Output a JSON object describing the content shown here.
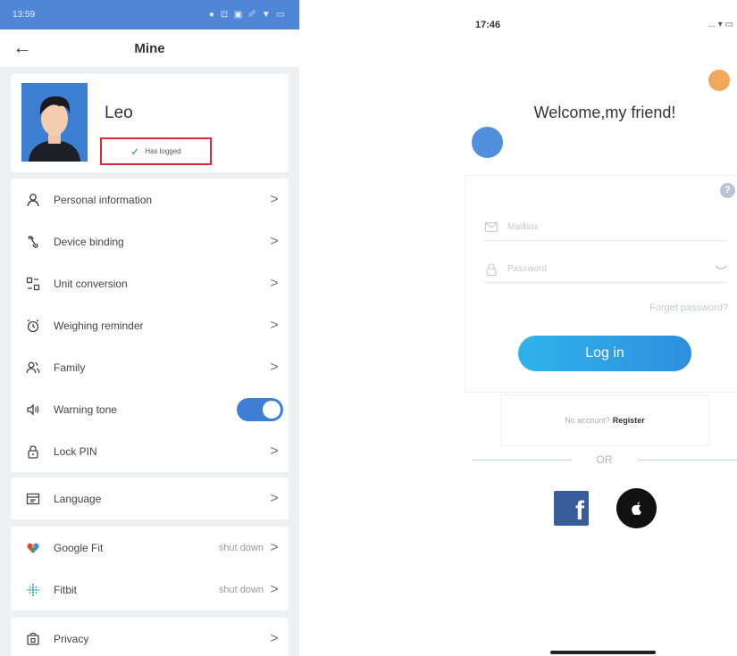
{
  "left": {
    "status": {
      "time": "13:59",
      "icons": "● ⊡ ▣ ␥ ▼ ▭"
    },
    "header": {
      "title": "Mine",
      "back": "←"
    },
    "profile": {
      "name": "Leo",
      "status": "Has logged",
      "check": "✓"
    },
    "menu_main": [
      {
        "icon": "person-icon",
        "label": "Personal information",
        "chev": ">"
      },
      {
        "icon": "link-icon",
        "label": "Device binding",
        "chev": ">"
      },
      {
        "icon": "unit-conversion-icon",
        "label": "Unit conversion",
        "chev": ">"
      },
      {
        "icon": "alarm-clock-icon",
        "label": "Weighing reminder",
        "chev": ">"
      },
      {
        "icon": "family-icon",
        "label": "Family",
        "chev": ">"
      },
      {
        "icon": "speaker-icon",
        "label": "Warning tone",
        "toggle": true
      },
      {
        "icon": "lock-icon",
        "label": "Lock PIN",
        "chev": ">"
      }
    ],
    "menu_language": {
      "icon": "language-icon",
      "label": "Language",
      "chev": ">"
    },
    "menu_health": [
      {
        "icon": "google-fit-icon",
        "label": "Google Fit",
        "value": "shut down",
        "chev": ">"
      },
      {
        "icon": "fitbit-icon",
        "label": "Fitbit",
        "value": "shut down",
        "chev": ">"
      }
    ],
    "menu_privacy": {
      "icon": "shield-icon",
      "label": "Privacy",
      "chev": ">"
    }
  },
  "right": {
    "status": {
      "time": "17:46",
      "icons": "... ▾ ▭"
    },
    "welcome": "Welcome,my friend!",
    "help": "?",
    "mailbox_placeholder": "Mailbox",
    "password_placeholder": "Password",
    "forgot": "Forget password?",
    "login": "Log in",
    "no_account": "No account?",
    "register": "Register",
    "or": "OR",
    "facebook": "f"
  }
}
